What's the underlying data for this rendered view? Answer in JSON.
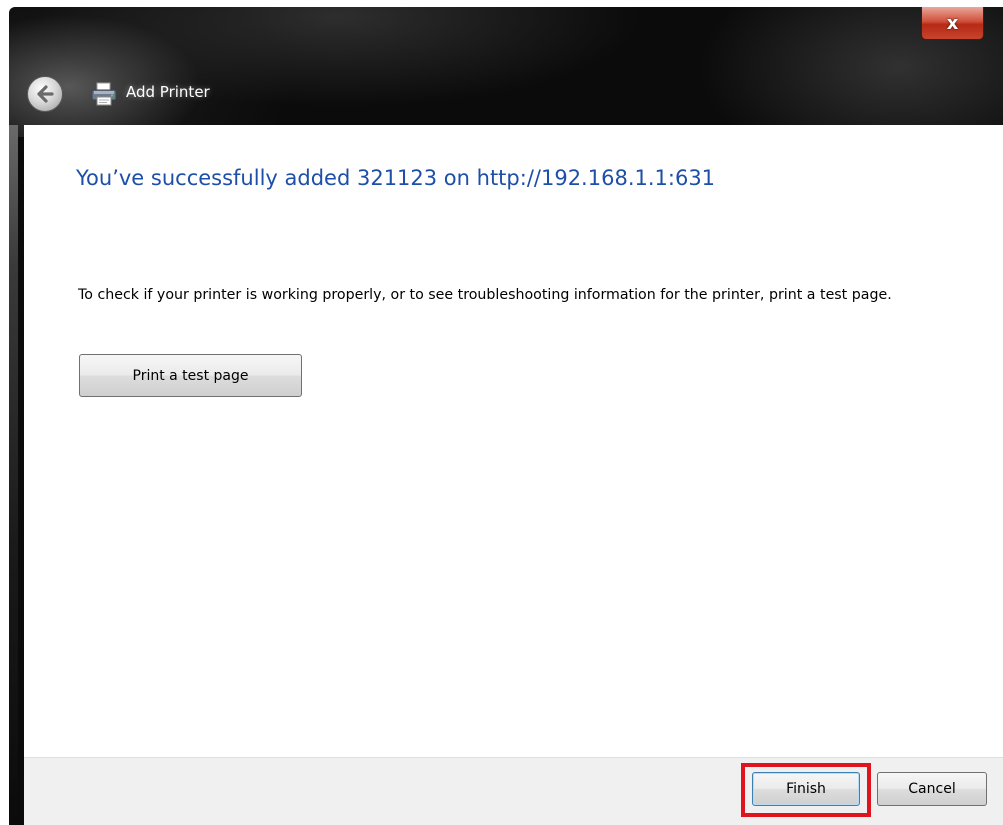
{
  "window": {
    "title": "Add Printer",
    "close_label": "x"
  },
  "content": {
    "heading": "You’ve successfully added 321123 on http://192.168.1.1:631",
    "description": "To check if your printer is working properly, or to see troubleshooting information for the printer, print a test page.",
    "test_button_label": "Print a test page"
  },
  "footer": {
    "finish_label": "Finish",
    "cancel_label": "Cancel"
  },
  "icons": {
    "back": "back-arrow-icon",
    "title": "printer-icon",
    "close": "close-icon"
  },
  "colors": {
    "heading": "#1e4fa8",
    "close_button": "#c8442c",
    "highlight": "#e0141e",
    "frame": "#0b0b0b",
    "footer": "#f0f0f0"
  }
}
